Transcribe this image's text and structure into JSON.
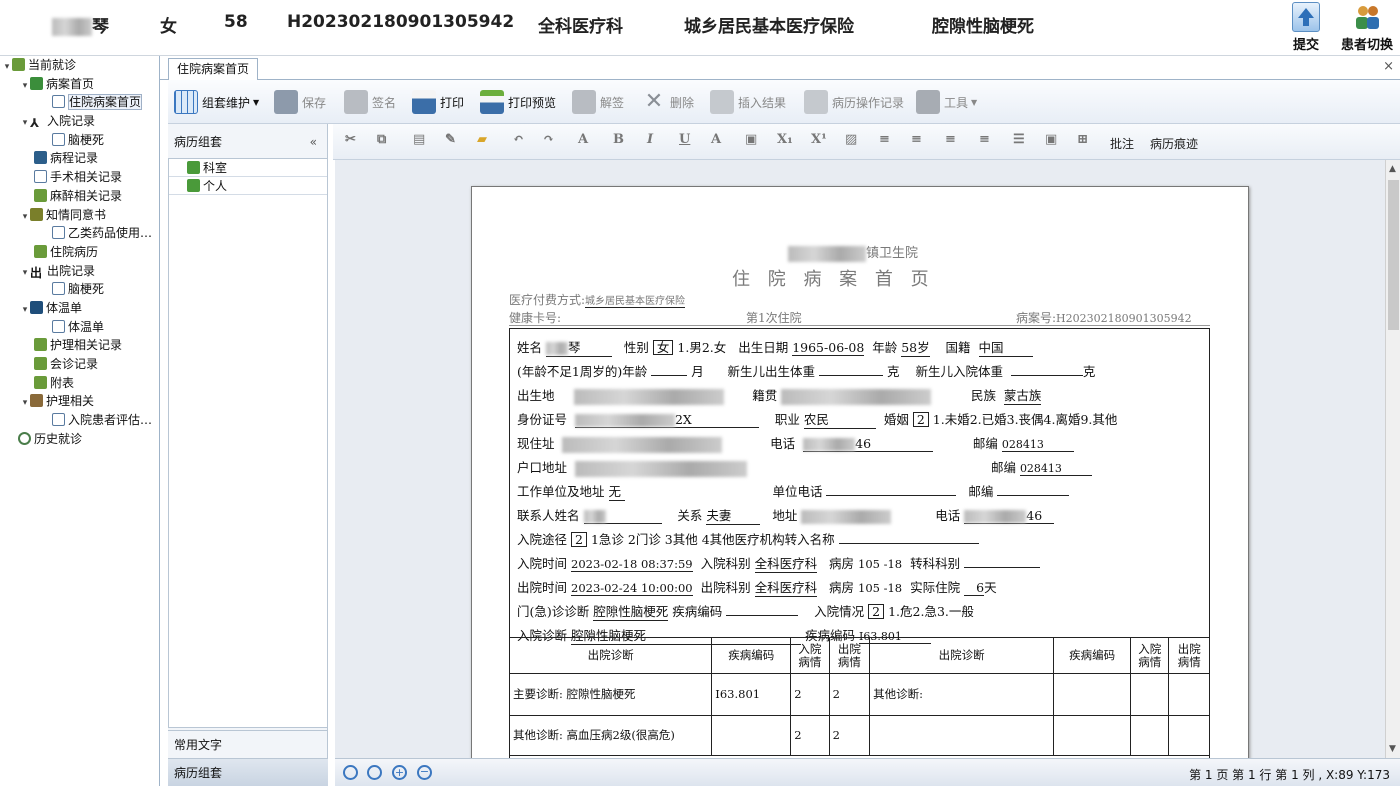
{
  "header": {
    "name_suffix": "琴",
    "gender": "女",
    "age": "58",
    "case_id": "H202302180901305942",
    "department": "全科医疗科",
    "insurance": "城乡居民基本医疗保险",
    "diagnosis": "腔隙性脑梗死",
    "submit_label": "提交",
    "switch_label": "患者切换"
  },
  "tree": {
    "items": [
      {
        "label": "当前就诊"
      },
      {
        "label": "病案首页"
      },
      {
        "label": "住院病案首页"
      },
      {
        "label": "入院记录"
      },
      {
        "label": "脑梗死"
      },
      {
        "label": "病程记录"
      },
      {
        "label": "手术相关记录"
      },
      {
        "label": "麻醉相关记录"
      },
      {
        "label": "知情同意书"
      },
      {
        "label": "乙类药品使用…"
      },
      {
        "label": "住院病历"
      },
      {
        "label": "出院记录"
      },
      {
        "label": "脑梗死"
      },
      {
        "label": "体温单"
      },
      {
        "label": "体温单"
      },
      {
        "label": "护理相关记录"
      },
      {
        "label": "会诊记录"
      },
      {
        "label": "附表"
      },
      {
        "label": "护理相关"
      },
      {
        "label": "入院患者评估…"
      },
      {
        "label": "历史就诊"
      }
    ]
  },
  "tab": {
    "label": "住院病案首页",
    "close": "×"
  },
  "toolbar": {
    "group": "组套维护",
    "save": "保存",
    "sign": "签名",
    "print": "打印",
    "preview": "打印预览",
    "unsign": "解签",
    "delete": "删除",
    "insert_result": "插入结果",
    "history": "病历操作记录",
    "tools": "工具"
  },
  "panel": {
    "title": "病历组套",
    "collapse": "«",
    "items": [
      "科室",
      "个人"
    ],
    "common_text": "常用文字",
    "group_set": "病历组套"
  },
  "format": {
    "comment": "批注",
    "trace": "病历痕迹"
  },
  "document": {
    "hospital": "镇卫生院",
    "title": "住 院 病 案 首 页",
    "pay_label": "医疗付费方式:",
    "pay_value": "城乡居民基本医疗保险",
    "card_label": "健康卡号:",
    "visit": "第1次住院",
    "case_label": "病案号:",
    "case_value": "H202302180901305942",
    "name_label": "姓名",
    "name_value": "琴",
    "sex_label": "性别",
    "sex_value": "女",
    "sex_options": "1.男2.女",
    "birth_label": "出生日期",
    "birth_value": "1965-06-08",
    "age_label": "年龄",
    "age_value": "58岁",
    "nation_label": "国籍",
    "nation_value": "中国",
    "infant_age": "(年龄不足1周岁的)年龄",
    "month": "月",
    "newborn_weight": "新生儿出生体重",
    "gram": "克",
    "newborn_in_weight": "新生儿入院体重",
    "gram2": "克",
    "birthplace": "出生地",
    "native_label": "籍贯",
    "ethnic_label": "民族",
    "ethnic_value": "蒙古族",
    "id_label": "身份证号",
    "id_tail": "2X",
    "job_label": "职业",
    "job_value": "农民",
    "marriage_label": "婚姻",
    "marriage_value": "2",
    "marriage_options": "1.未婚2.已婚3.丧偶4.离婚9.其他",
    "addr_label": "现住址",
    "phone_label": "电话",
    "phone_tail": "46",
    "zip_label": "邮编",
    "zip_value": "028413",
    "hukou_label": "户口地址",
    "zip_label2": "邮编",
    "zip_value2": "028413",
    "work_label": "工作单位及地址",
    "work_value": "无",
    "work_phone": "单位电话",
    "zip_label3": "邮编",
    "contact_label": "联系人姓名",
    "relation_label": "关系",
    "relation_value": "夫妻",
    "contact_addr": "地址",
    "contact_phone": "电话",
    "contact_phone_tail": "46",
    "route_label": "入院途径",
    "route_value": "2",
    "route_options": "1急诊 2门诊 3其他 4其他医疗机构转入名称",
    "in_time_label": "入院时间",
    "in_time_value": "2023-02-18 08:37:59",
    "in_dept_label": "入院科别",
    "in_dept_value": "全科医疗科",
    "ward_label": "病房",
    "ward_value": "105 -18",
    "transfer_label": "转科科别",
    "out_time_label": "出院时间",
    "out_time_value": "2023-02-24 10:00:00",
    "out_dept_label": "出院科别",
    "out_dept_value": "全科医疗科",
    "ward_label2": "病房",
    "ward_value2": "105 -18",
    "stay_label": "实际住院",
    "stay_value": "6",
    "stay_unit": "天",
    "op_diag_label": "门(急)诊诊断",
    "op_diag_value": "腔隙性脑梗死",
    "disease_code_label": "疾病编码",
    "admit_state_label": "入院情况",
    "admit_state_value": "2",
    "admit_state_options": "1.危2.急3.一般",
    "in_diag_label": "入院诊断",
    "in_diag_value": "腔隙性脑梗死",
    "disease_code_label2": "疾病编码",
    "in_diag_code": "I63.801",
    "table": {
      "col_diag": "出院诊断",
      "col_code": "疾病编码",
      "col_in": "入院病情",
      "col_out": "出院病情",
      "row1_diag": "主要诊断: 腔隙性脑梗死",
      "row1_code": "I63.801",
      "row1_in": "2",
      "row1_out": "2",
      "row1_other": "其他诊断:",
      "row2_diag": "其他诊断: 高血压病2级(很高危)",
      "row2_in": "2",
      "row2_out": "2"
    }
  },
  "status": {
    "position": "第 1 页 第 1 行 第 1 列 , X:89 Y:173"
  }
}
